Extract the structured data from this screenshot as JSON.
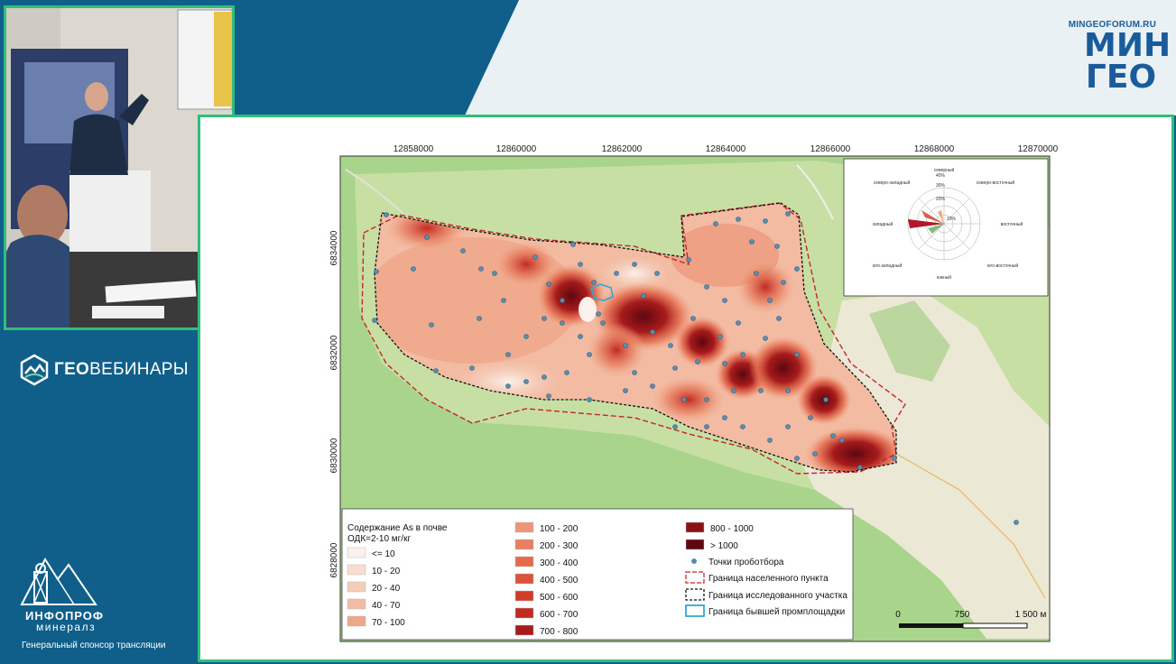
{
  "header": {
    "brand_url": "MINGEOFORUM.RU",
    "brand_line1": "МИН",
    "brand_line2": "ГЕО"
  },
  "sidebar": {
    "logo_text_bold": "ГЕО",
    "logo_text_rest": "ВЕБИНАРЫ",
    "sponsor_name_line1": "ИНФОПРОФ",
    "sponsor_name_line2": "минералз",
    "sponsor_caption": "Генеральный спонсор трансляции"
  },
  "map": {
    "x_ticks": [
      "12858000",
      "12860000",
      "12862000",
      "12864000",
      "12866000",
      "12868000",
      "12870000"
    ],
    "y_ticks": [
      "6834000",
      "6832000",
      "6830000",
      "6828000"
    ],
    "legend_title_line1": "Содержание As в почве",
    "legend_title_line2": "ОДК=2-10 мг/кг",
    "classes": [
      {
        "label": "<= 10",
        "color": "#fbf1ec"
      },
      {
        "label": "10 - 20",
        "color": "#f8ddd0"
      },
      {
        "label": "20 - 40",
        "color": "#f5cdb8"
      },
      {
        "label": "40 - 70",
        "color": "#f2bba2"
      },
      {
        "label": "70 - 100",
        "color": "#efa78a"
      },
      {
        "label": "100 - 200",
        "color": "#ec9677"
      },
      {
        "label": "200 - 300",
        "color": "#e87f60"
      },
      {
        "label": "300 - 400",
        "color": "#e46a4c"
      },
      {
        "label": "400 - 500",
        "color": "#dd523a"
      },
      {
        "label": "500 - 600",
        "color": "#d23b2c"
      },
      {
        "label": "600 - 700",
        "color": "#c22a22"
      },
      {
        "label": "700 - 800",
        "color": "#a81b1b"
      },
      {
        "label": "800 - 1000",
        "color": "#8a1116"
      },
      {
        "label": "> 1000",
        "color": "#5e0710"
      }
    ],
    "sampling_points_label": "Точки пробoтбора",
    "settlement_boundary_label": "Граница населенного пункта",
    "study_area_boundary_label": "Граница исследованного участка",
    "former_site_boundary_label": "Граница бывшей промплощадки",
    "scale_labels": [
      "0",
      "750",
      "1 500 м"
    ],
    "rose": {
      "directions": {
        "n": "северный",
        "ne": "северо-восточный",
        "e": "восточный",
        "se": "юго-восточный",
        "s": "южный",
        "sw": "юго-западный",
        "w": "западный",
        "nw": "северо-западный"
      },
      "rings": [
        "10%",
        "20%",
        "30%",
        "40%"
      ]
    }
  }
}
